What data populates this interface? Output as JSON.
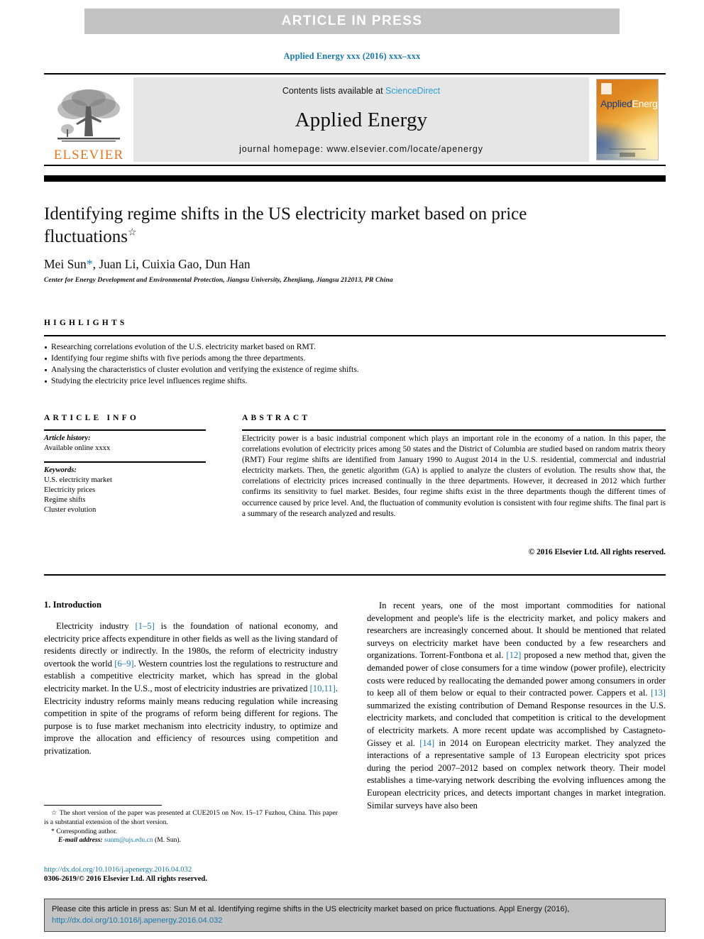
{
  "banner": {
    "text": "ARTICLE  IN  PRESS"
  },
  "journal_ref": "Applied Energy xxx (2016) xxx–xxx",
  "masthead": {
    "publisher": "ELSEVIER",
    "contents_prefix": "Contents lists available at ",
    "contents_link": "ScienceDirect",
    "journal_title": "Applied Energy",
    "homepage": "journal homepage: www.elsevier.com/locate/apenergy",
    "cover_title_a": "Applied",
    "cover_title_b": "Energy"
  },
  "article": {
    "title": "Identifying regime shifts in the US electricity market based on price fluctuations",
    "title_marker": "☆",
    "authors_pre": "Mei Sun",
    "authors_star": "*",
    "authors_post": ", Juan Li, Cuixia Gao, Dun Han",
    "affiliation": "Center for Energy Development and Environmental Protection, Jiangsu University, Zhenjiang, Jiangsu 212013, PR China"
  },
  "highlights": {
    "heading": "HIGHLIGHTS",
    "items": [
      "Researching correlations evolution of the U.S. electricity market based on RMT.",
      "Identifying four regime shifts with five periods among the three departments.",
      "Analysing the characteristics of cluster evolution and verifying the existence of regime shifts.",
      "Studying the electricity price level influences regime shifts."
    ]
  },
  "article_info": {
    "heading": "ARTICLE INFO",
    "history_label": "Article history:",
    "history_value": "Available online xxxx",
    "keywords_label": "Keywords:",
    "keywords": [
      "U.S. electricity market",
      "Electricity prices",
      "Regime shifts",
      "Cluster evolution"
    ]
  },
  "abstract": {
    "heading": "ABSTRACT",
    "body": "Electricity power is a basic industrial component which plays an important role in the economy of a nation. In this paper, the correlations evolution of electricity prices among 50 states and the District of Columbia are studied based on random matrix theory (RMT) Four regime shifts are identified from January 1990 to August 2014 in the U.S. residential, commercial and industrial electricity markets. Then, the genetic algorithm (GA) is applied to analyze the clusters of evolution. The results show that, the correlations of electricity prices increased continually in the three departments. However, it decreased in 2012 which further confirms its sensitivity to fuel market. Besides, four regime shifts exist in the three departments though the different times of occurrence caused by price level. And, the fluctuation of community evolution is consistent with four regime shifts. The final part is a summary of the research analyzed and results.",
    "copyright": "© 2016 Elsevier Ltd. All rights reserved."
  },
  "body": {
    "section_title": "1. Introduction",
    "left_para_1_a": "Electricity industry ",
    "left_para_1_ref1": "[1–5]",
    "left_para_1_b": " is the foundation of national economy, and electricity price affects expenditure in other fields as well as the living standard of residents directly or indirectly. In the 1980s, the reform of electricity industry overtook the world ",
    "left_para_1_ref2": "[6–9]",
    "left_para_1_c": ". Western countries lost the regulations to restructure and establish a competitive electricity market, which has spread in the global electricity market. In the U.S., most of electricity industries are privatized ",
    "left_para_1_ref3": "[10,11]",
    "left_para_1_d": ". Electricity industry reforms mainly means reducing regulation while increasing competition in spite of the programs of reform being different for regions. The purpose is to fuse market mechanism into electricity industry, to optimize and improve the allocation and efficiency of resources using competition and privatization.",
    "right_para_1_a": "In recent years, one of the most important commodities for national development and people's life is the electricity market, and policy makers and researchers are increasingly concerned about. It should be mentioned that related surveys on electricity market have been conducted by a few researchers and organizations. Torrent-Fontbona et al. ",
    "right_para_1_ref1": "[12]",
    "right_para_1_b": " proposed a new method that, given the demanded power of close consumers for a time window (power profile), electricity costs were reduced by reallocating the demanded power among consumers in order to keep all of them below or equal to their contracted power. Cappers et al. ",
    "right_para_1_ref2": "[13]",
    "right_para_1_c": " summarized the existing contribution of Demand Response resources in the U.S. electricity markets, and concluded that competition is critical to the development of electricity markets. A more recent update was accomplished by Castagneto-Gissey et al. ",
    "right_para_1_ref3": "[14]",
    "right_para_1_d": " in 2014 on European electricity market. They analyzed the interactions of a representative sample of 13 European electricity spot prices during the period 2007–2012 based on complex network theory. Their model establishes a time-varying network describing the evolving influences among the European electricity prices, and detects important changes in market integration. Similar surveys have also been"
  },
  "footnotes": {
    "star_note": "The short version of the paper was presented at CUE2015 on Nov. 15–17 Fuzhou, China. This paper is a substantial extension of the short version.",
    "corresponding": "Corresponding author.",
    "email_label": "E-mail address:",
    "email_value": "sunm@ujs.edu.cn",
    "email_suffix": "(M. Sun).",
    "doi": "http://dx.doi.org/10.1016/j.apenergy.2016.04.032",
    "issn_line": "0306-2619/© 2016 Elsevier Ltd. All rights reserved."
  },
  "citation_box": {
    "text": "Please cite this article in press as: Sun M et al. Identifying regime shifts in the US electricity market based on price fluctuations. Appl Energy (2016), ",
    "link": "http://dx.doi.org/10.1016/j.apenergy.2016.04.032"
  },
  "colors": {
    "link_blue": "#1a78ad",
    "sciencedirect_blue": "#2a9fd6",
    "elsevier_orange": "#e87722",
    "banner_gray": "#c3c3c3",
    "masthead_gray": "#e6e6e6"
  }
}
